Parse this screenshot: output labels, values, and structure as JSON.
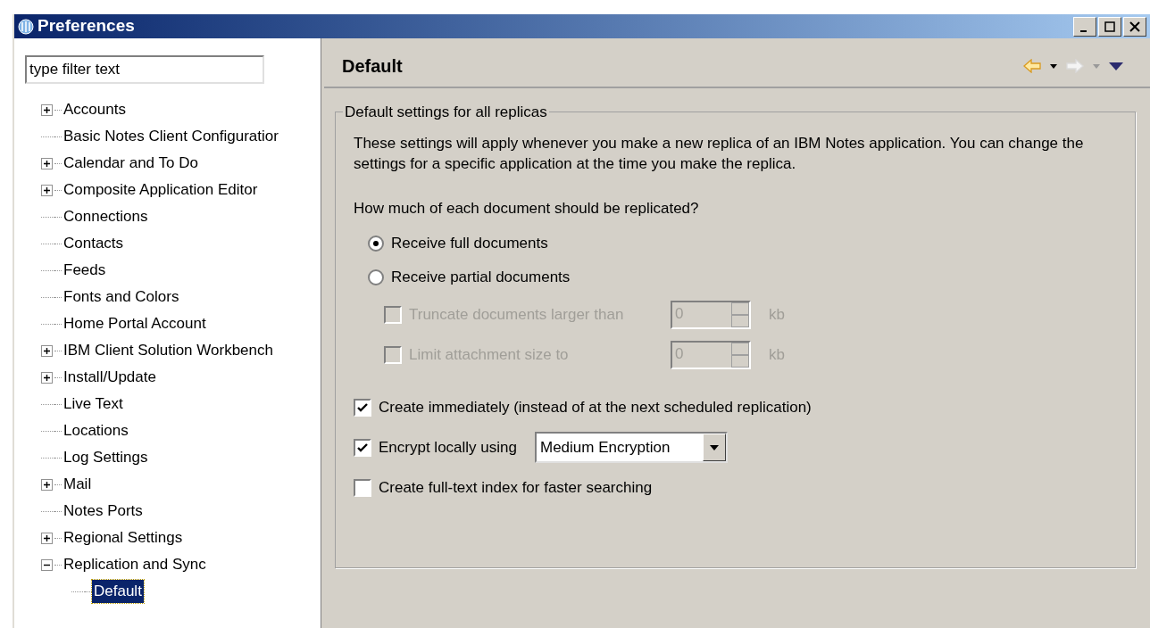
{
  "window": {
    "title": "Preferences"
  },
  "filter": {
    "placeholder": "type filter text"
  },
  "tree": [
    {
      "label": "Accounts",
      "kind": "folder",
      "expanded": false,
      "selected": false
    },
    {
      "label": "Basic Notes Client Configuratior",
      "kind": "leaf",
      "selected": false
    },
    {
      "label": "Calendar and To Do",
      "kind": "folder",
      "expanded": false,
      "selected": false
    },
    {
      "label": "Composite Application Editor",
      "kind": "folder",
      "expanded": false,
      "selected": false
    },
    {
      "label": "Connections",
      "kind": "leaf",
      "selected": false
    },
    {
      "label": "Contacts",
      "kind": "leaf",
      "selected": false
    },
    {
      "label": "Feeds",
      "kind": "leaf",
      "selected": false
    },
    {
      "label": "Fonts and Colors",
      "kind": "leaf",
      "selected": false
    },
    {
      "label": "Home Portal Account",
      "kind": "leaf",
      "selected": false
    },
    {
      "label": "IBM Client Solution Workbench",
      "kind": "folder",
      "expanded": false,
      "selected": false
    },
    {
      "label": "Install/Update",
      "kind": "folder",
      "expanded": false,
      "selected": false
    },
    {
      "label": "Live Text",
      "kind": "leaf",
      "selected": false
    },
    {
      "label": "Locations",
      "kind": "leaf",
      "selected": false
    },
    {
      "label": "Log Settings",
      "kind": "leaf",
      "selected": false
    },
    {
      "label": "Mail",
      "kind": "folder",
      "expanded": false,
      "selected": false
    },
    {
      "label": "Notes Ports",
      "kind": "leaf",
      "selected": false
    },
    {
      "label": "Regional Settings",
      "kind": "folder",
      "expanded": false,
      "selected": false
    },
    {
      "label": "Replication and Sync",
      "kind": "folder",
      "expanded": true,
      "selected": false,
      "children": [
        {
          "label": "Default",
          "selected": true
        }
      ]
    }
  ],
  "page": {
    "title": "Default",
    "group": {
      "title": "Default settings for all replicas",
      "intro": "These settings will apply whenever you make a new replica of an IBM Notes application. You can change the settings for a specific application at the time you make the replica.",
      "question": "How much of each document should be replicated?",
      "radios": [
        {
          "label": "Receive full documents",
          "selected": true
        },
        {
          "label": "Receive partial documents",
          "selected": false
        }
      ],
      "limits": [
        {
          "label": "Truncate documents larger than",
          "checked": false,
          "disabled": true,
          "value": "0",
          "unit": "kb"
        },
        {
          "label": "Limit attachment size to",
          "checked": false,
          "disabled": true,
          "value": "0",
          "unit": "kb"
        }
      ],
      "options": [
        {
          "kind": "check",
          "label": "Create immediately (instead of at the next scheduled replication)",
          "checked": true
        },
        {
          "kind": "dropdown",
          "label": "Encrypt locally using",
          "checked": true,
          "value": "Medium Encryption"
        },
        {
          "kind": "check",
          "label": "Create full-text index for faster searching",
          "checked": false
        }
      ]
    }
  }
}
